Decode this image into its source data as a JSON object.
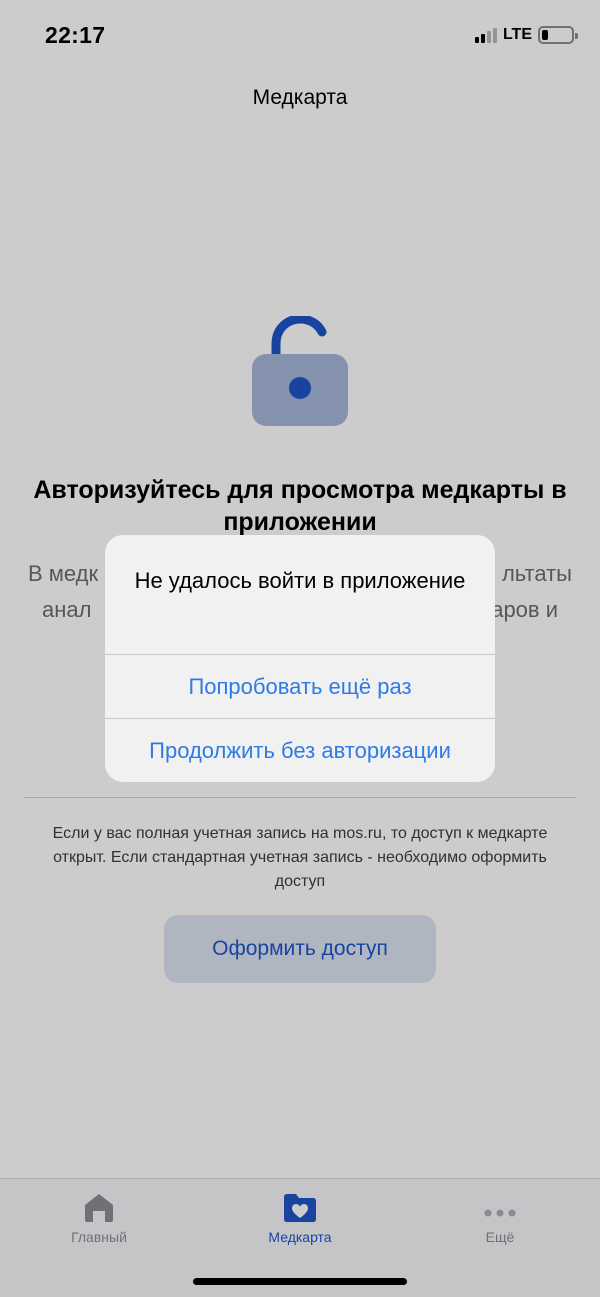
{
  "status_bar": {
    "time": "22:17",
    "network": "LTE"
  },
  "nav": {
    "title": "Медкарта"
  },
  "content": {
    "headline": "Авторизуйтесь для просмотра медкарты в приложении",
    "description_visible_left_1": "В медк",
    "description_visible_right_1": "льтаты",
    "description_visible_left_2": "анал",
    "description_visible_right_2": "аров и",
    "info_text": "Если у вас полная учетная запись на mos.ru, то доступ к медкарте открыт. Если стандартная учетная запись - необходимо оформить доступ",
    "cta_label": "Оформить доступ"
  },
  "alert": {
    "title": "Не удалось войти в приложение",
    "retry_label": "Попробовать ещё раз",
    "continue_label": "Продолжить без авторизации"
  },
  "tabbar": {
    "items": [
      {
        "label": "Главный",
        "icon": "home-icon",
        "active": false
      },
      {
        "label": "Медкарта",
        "icon": "medcard-heart-folder-icon",
        "active": true
      },
      {
        "label": "Ещё",
        "icon": "more-dots-icon",
        "active": false
      }
    ]
  },
  "colors": {
    "accent": "#1f55c9",
    "alert_button": "#2f7be6",
    "lock_body": "#a7b7d9",
    "inactive_tab": "#8e8e93"
  }
}
